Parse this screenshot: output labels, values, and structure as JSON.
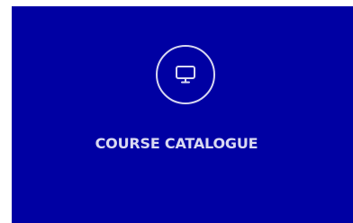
{
  "tile": {
    "label": "COURSE CATALOGUE",
    "icon": "monitor-icon",
    "background_color": "#0000a3",
    "foreground_color": "#d9d9f2"
  }
}
